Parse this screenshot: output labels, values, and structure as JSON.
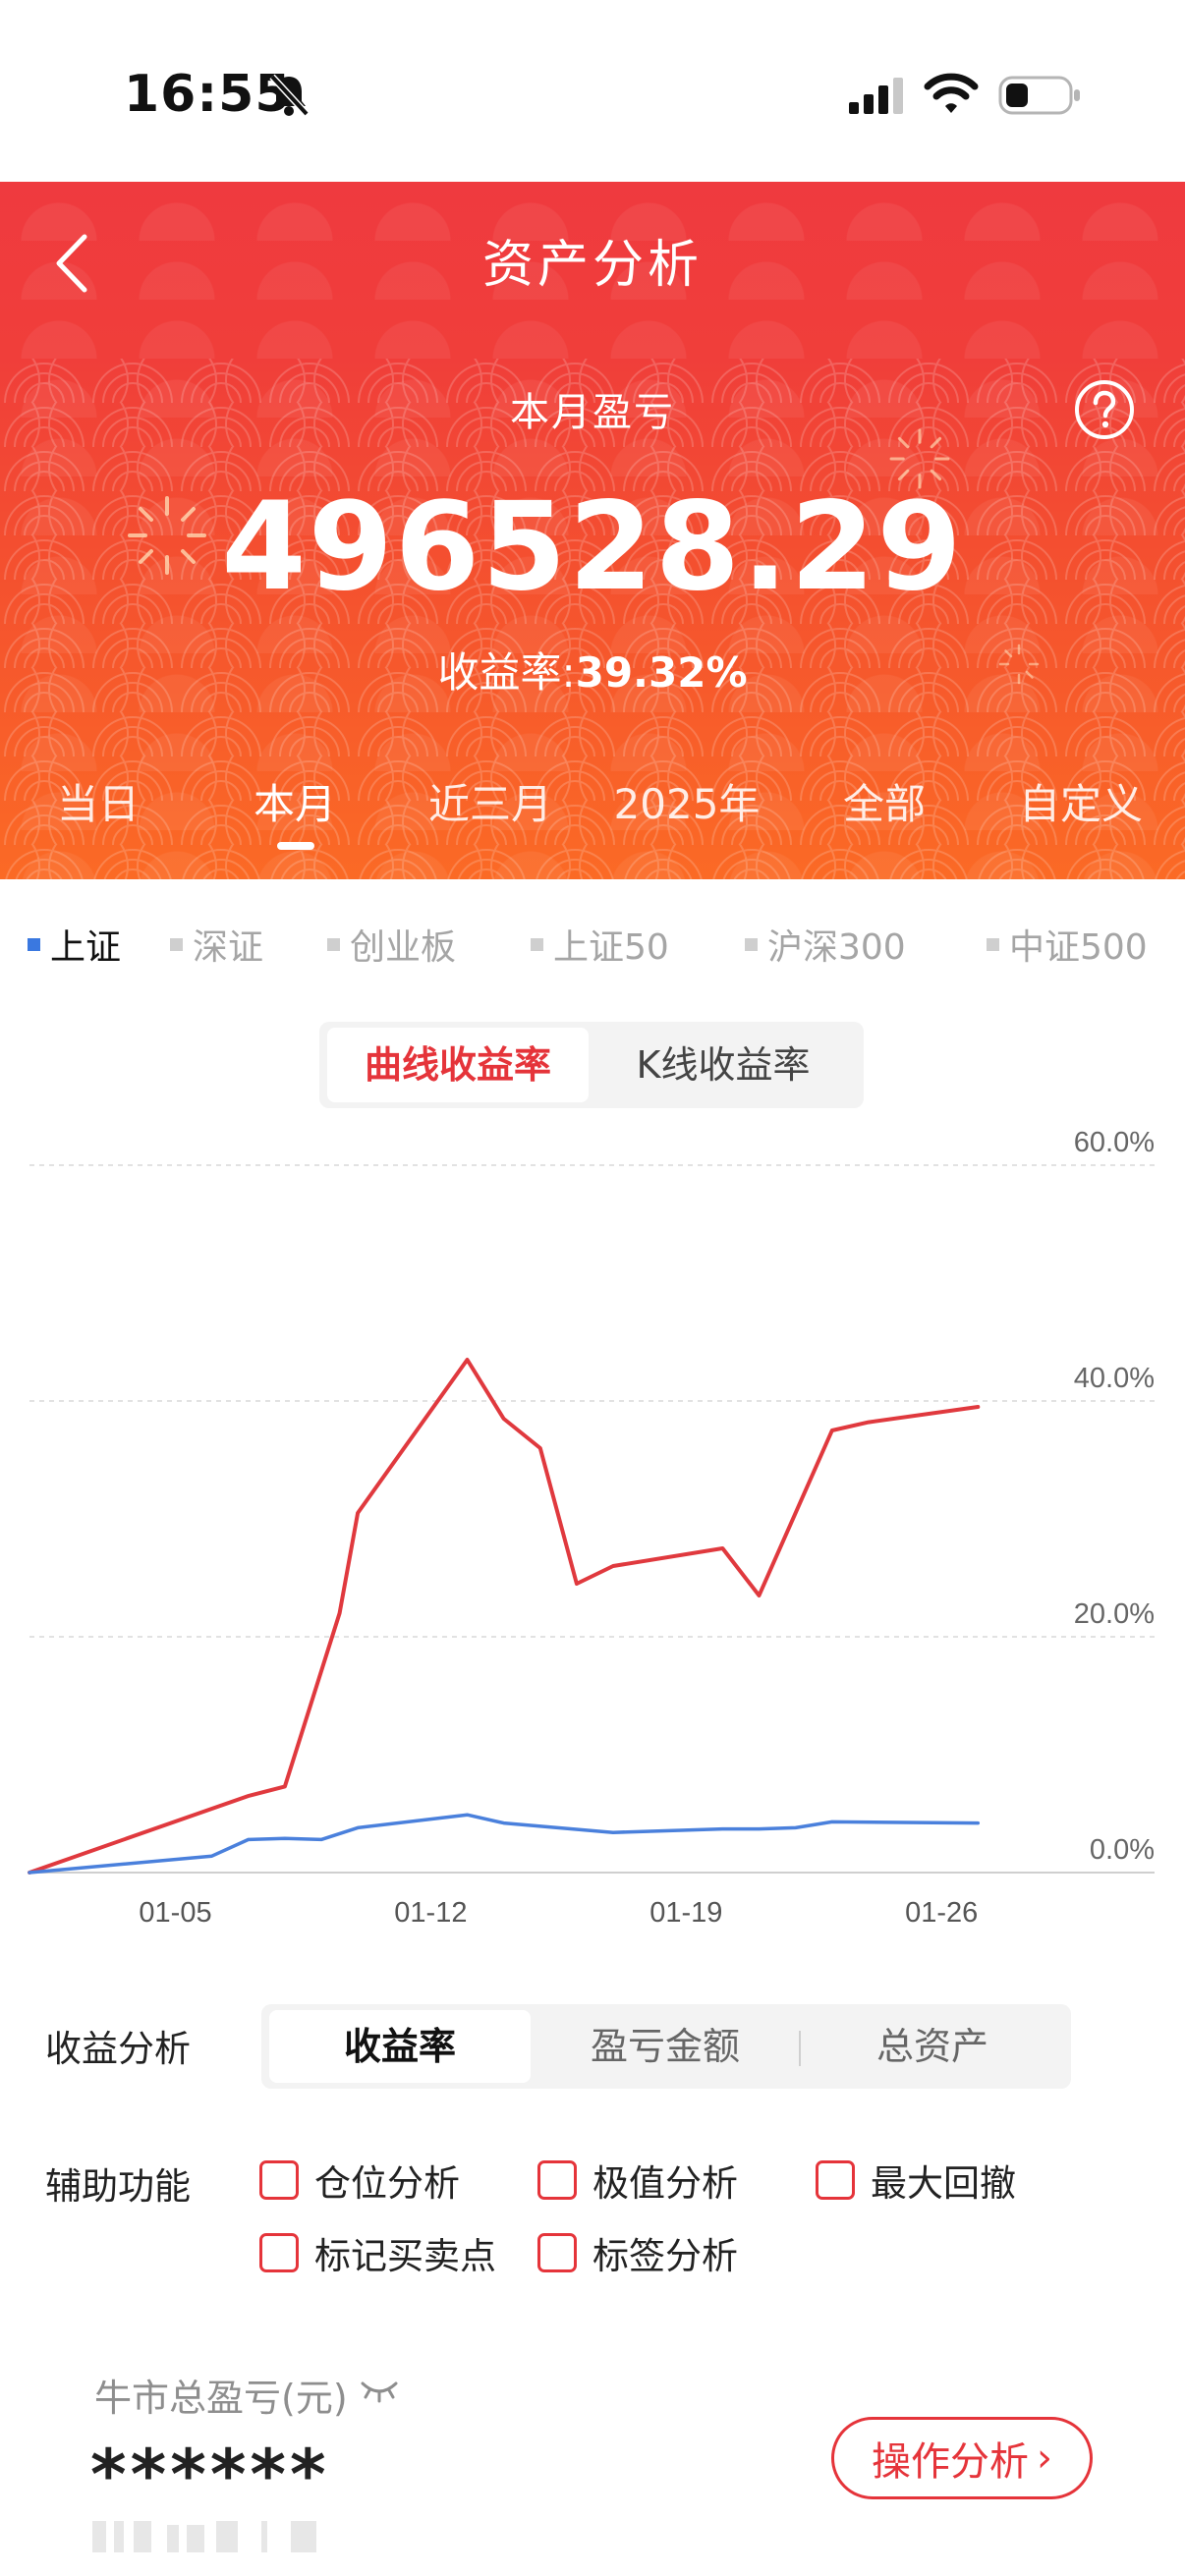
{
  "status_bar": {
    "time": "16:55",
    "icons": [
      "bell-slash-icon",
      "signal-icon",
      "wifi-icon",
      "battery-icon"
    ]
  },
  "header": {
    "title": "资产分析",
    "back_icon": "chevron-left-icon",
    "help_icon": "question-circle-icon"
  },
  "summary": {
    "label": "本月盈亏",
    "amount": "496528.29",
    "rate_label": "收益率:",
    "rate_value": "39.32%"
  },
  "period_tabs": [
    {
      "label": "当日",
      "active": false
    },
    {
      "label": "本月",
      "active": true
    },
    {
      "label": "近三月",
      "active": false
    },
    {
      "label": "2025年",
      "active": false
    },
    {
      "label": "全部",
      "active": false
    },
    {
      "label": "自定义",
      "active": false
    }
  ],
  "index_selector": [
    {
      "label": "上证",
      "active": true
    },
    {
      "label": "深证",
      "active": false
    },
    {
      "label": "创业板",
      "active": false
    },
    {
      "label": "上证50",
      "active": false
    },
    {
      "label": "沪深300",
      "active": false
    },
    {
      "label": "中证500",
      "active": false
    }
  ],
  "chart_mode": {
    "active": "曲线收益率",
    "inactive": "K线收益率"
  },
  "chart_data": {
    "type": "line",
    "x_ticks": [
      "01-05",
      "01-12",
      "01-19",
      "01-26"
    ],
    "y_ticks": [
      "60.0%",
      "40.0%",
      "20.0%",
      "0.0%"
    ],
    "ylim": [
      0,
      60
    ],
    "grid": true,
    "series": [
      {
        "color": "#e0393e",
        "points": [
          [
            0,
            0
          ],
          [
            6,
            6.5
          ],
          [
            7,
            7.3
          ],
          [
            8.5,
            22
          ],
          [
            9,
            30.5
          ],
          [
            12,
            43.5
          ],
          [
            13,
            38.5
          ],
          [
            14,
            36
          ],
          [
            15,
            24.5
          ],
          [
            16,
            26
          ],
          [
            19,
            27.5
          ],
          [
            20,
            23.5
          ],
          [
            22,
            37.5
          ],
          [
            23,
            38.2
          ],
          [
            26,
            39.5
          ]
        ]
      },
      {
        "color": "#4a80dc",
        "points": [
          [
            0,
            0
          ],
          [
            5,
            1.4
          ],
          [
            6,
            2.8
          ],
          [
            7,
            2.9
          ],
          [
            8,
            2.8
          ],
          [
            9,
            3.8
          ],
          [
            12,
            4.9
          ],
          [
            13,
            4.2
          ],
          [
            16,
            3.4
          ],
          [
            19,
            3.7
          ],
          [
            20,
            3.7
          ],
          [
            21,
            3.8
          ],
          [
            22,
            4.3
          ],
          [
            26,
            4.2
          ]
        ]
      }
    ]
  },
  "profit_analysis": {
    "label": "收益分析",
    "options": [
      "收益率",
      "盈亏金额",
      "总资产"
    ],
    "active_index": 0
  },
  "aux_functions": {
    "label": "辅助功能",
    "items": [
      "仓位分析",
      "极值分析",
      "最大回撤",
      "标记买卖点",
      "标签分析"
    ]
  },
  "bull_card": {
    "label": "牛市总盈亏(元)",
    "value": "******",
    "button": "操作分析",
    "eye_icon": "eye-closed-icon"
  },
  "colors": {
    "brand_red": "#e5343a",
    "header_top": "#ef3a3f",
    "header_bottom": "#fb6a25",
    "series_red": "#e0393e",
    "series_blue": "#4a80dc"
  }
}
